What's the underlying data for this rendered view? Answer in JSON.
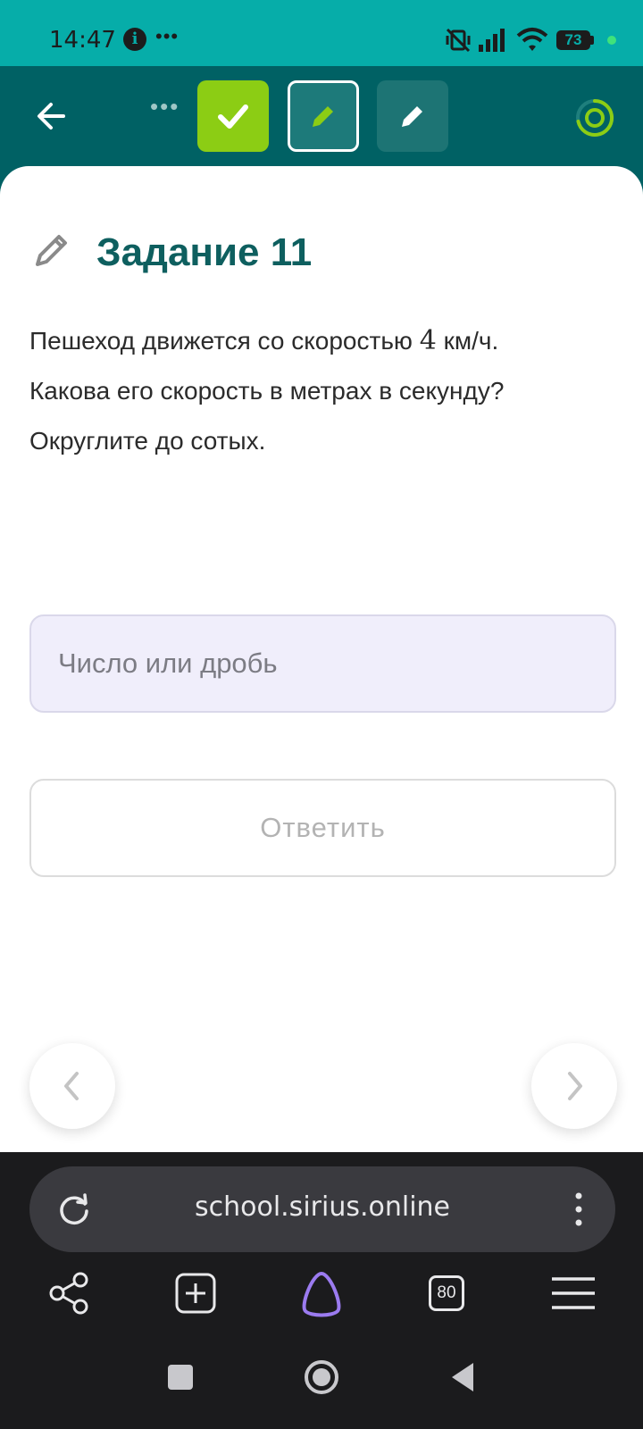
{
  "status_bar": {
    "time": "14:47",
    "info_icon": "info-circle-icon",
    "battery": "73",
    "colors": {
      "background": "#06ada9",
      "charge_dot": "#3fe27b"
    }
  },
  "toolbar": {
    "back_icon": "arrow-left-icon",
    "more_icon": "more-horizontal-icon",
    "tasks": [
      {
        "state": "completed",
        "icon": "check-icon",
        "color": "#8ccd14"
      },
      {
        "state": "current",
        "icon": "pencil-icon"
      },
      {
        "state": "pending",
        "icon": "pencil-icon"
      }
    ],
    "progress_icon": "progress-ring-icon",
    "colors": {
      "background": "#006164"
    }
  },
  "task": {
    "title": "Задание 11",
    "question_line1": "Пешеход движется со скоростью ",
    "question_number": "4",
    "question_line1_end": " км/ч.",
    "question_line2": "Какова его скорость в метрах в секунду?",
    "question_line3": "Округлите до сотых.",
    "answer_placeholder": "Число или дробь",
    "answer_value": "",
    "submit_label": "Ответить",
    "colors": {
      "title": "#0e5f5f",
      "input_bg": "#f0eefb"
    }
  },
  "browser": {
    "url": "school.sirius.online",
    "tab_count": "80",
    "icons": [
      "share-icon",
      "new-tab-icon",
      "alice-assistant-icon",
      "tabs-icon",
      "menu-icon"
    ]
  },
  "system_nav": {
    "icons": [
      "recents-square-icon",
      "home-circle-icon",
      "back-triangle-icon"
    ]
  }
}
